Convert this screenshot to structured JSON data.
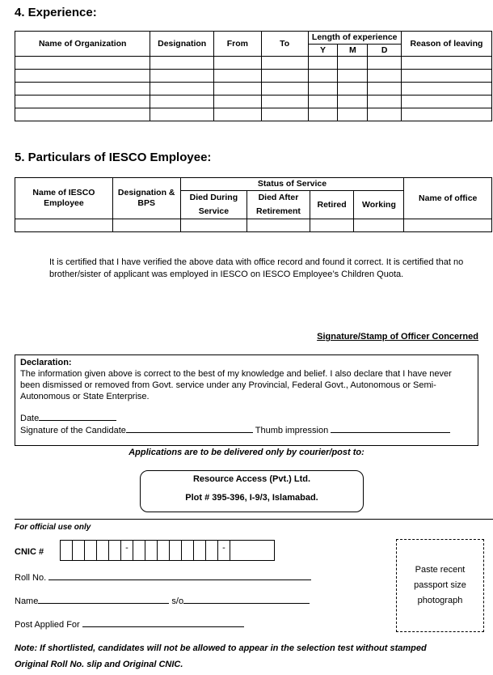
{
  "experience": {
    "heading": "4. Experience:",
    "columns": {
      "org": "Name of Organization",
      "designation": "Designation",
      "from": "From",
      "to": "To",
      "length": "Length of experience",
      "y": "Y",
      "m": "M",
      "d": "D",
      "reason": "Reason of leaving"
    },
    "blank_rows": 5
  },
  "employee": {
    "heading": "5. Particulars of IESCO Employee:",
    "columns": {
      "name": "Name of IESCO Employee",
      "designation": "Designation & BPS",
      "status": "Status of Service",
      "died_during": "Died During Service",
      "died_after": "Died After Retirement",
      "retired": "Retired",
      "working": "Working",
      "office": "Name of office"
    },
    "blank_rows": 1
  },
  "certification": {
    "text": "It is certified that I have verified the above data with office record and found it correct. It is certified that no brother/sister of applicant was employed in IESCO on IESCO Employee’s Children Quota.",
    "signature_label": "Signature/Stamp of Officer Concerned"
  },
  "declaration": {
    "title": "Declaration:",
    "text": "The information given above is correct to the best of my knowledge and belief. I also declare that I have never been dismissed or removed from Govt. service under any Provincial, Federal Govt., Autonomous or Semi-Autonomous or State Enterprise.",
    "date_label": "Date",
    "signature_label": "Signature of the Candidate",
    "thumb_label": "Thumb impression"
  },
  "delivery": {
    "instruction": "Applications are to be delivered only by courier/post to:",
    "address_line1": "Resource Access (Pvt.) Ltd.",
    "address_line2": "Plot # 395-396, I-9/3, Islamabad."
  },
  "official": {
    "heading": "For official use only",
    "cnic_label": "CNIC #",
    "cnic_boxes": [
      "",
      "",
      "",
      "",
      "",
      "-",
      "",
      "",
      "",
      "",
      "",
      "",
      "",
      "-",
      ""
    ],
    "roll_label": "Roll No.",
    "name_label": "Name",
    "so_label": "s/o",
    "post_label": "Post Applied For",
    "photo_text": "Paste recent passport size photograph",
    "note_line1": "Note: If shortlisted, candidates will not be allowed to appear in the selection test without stamped",
    "note_line2": "Original Roll No. slip and Original CNIC."
  }
}
